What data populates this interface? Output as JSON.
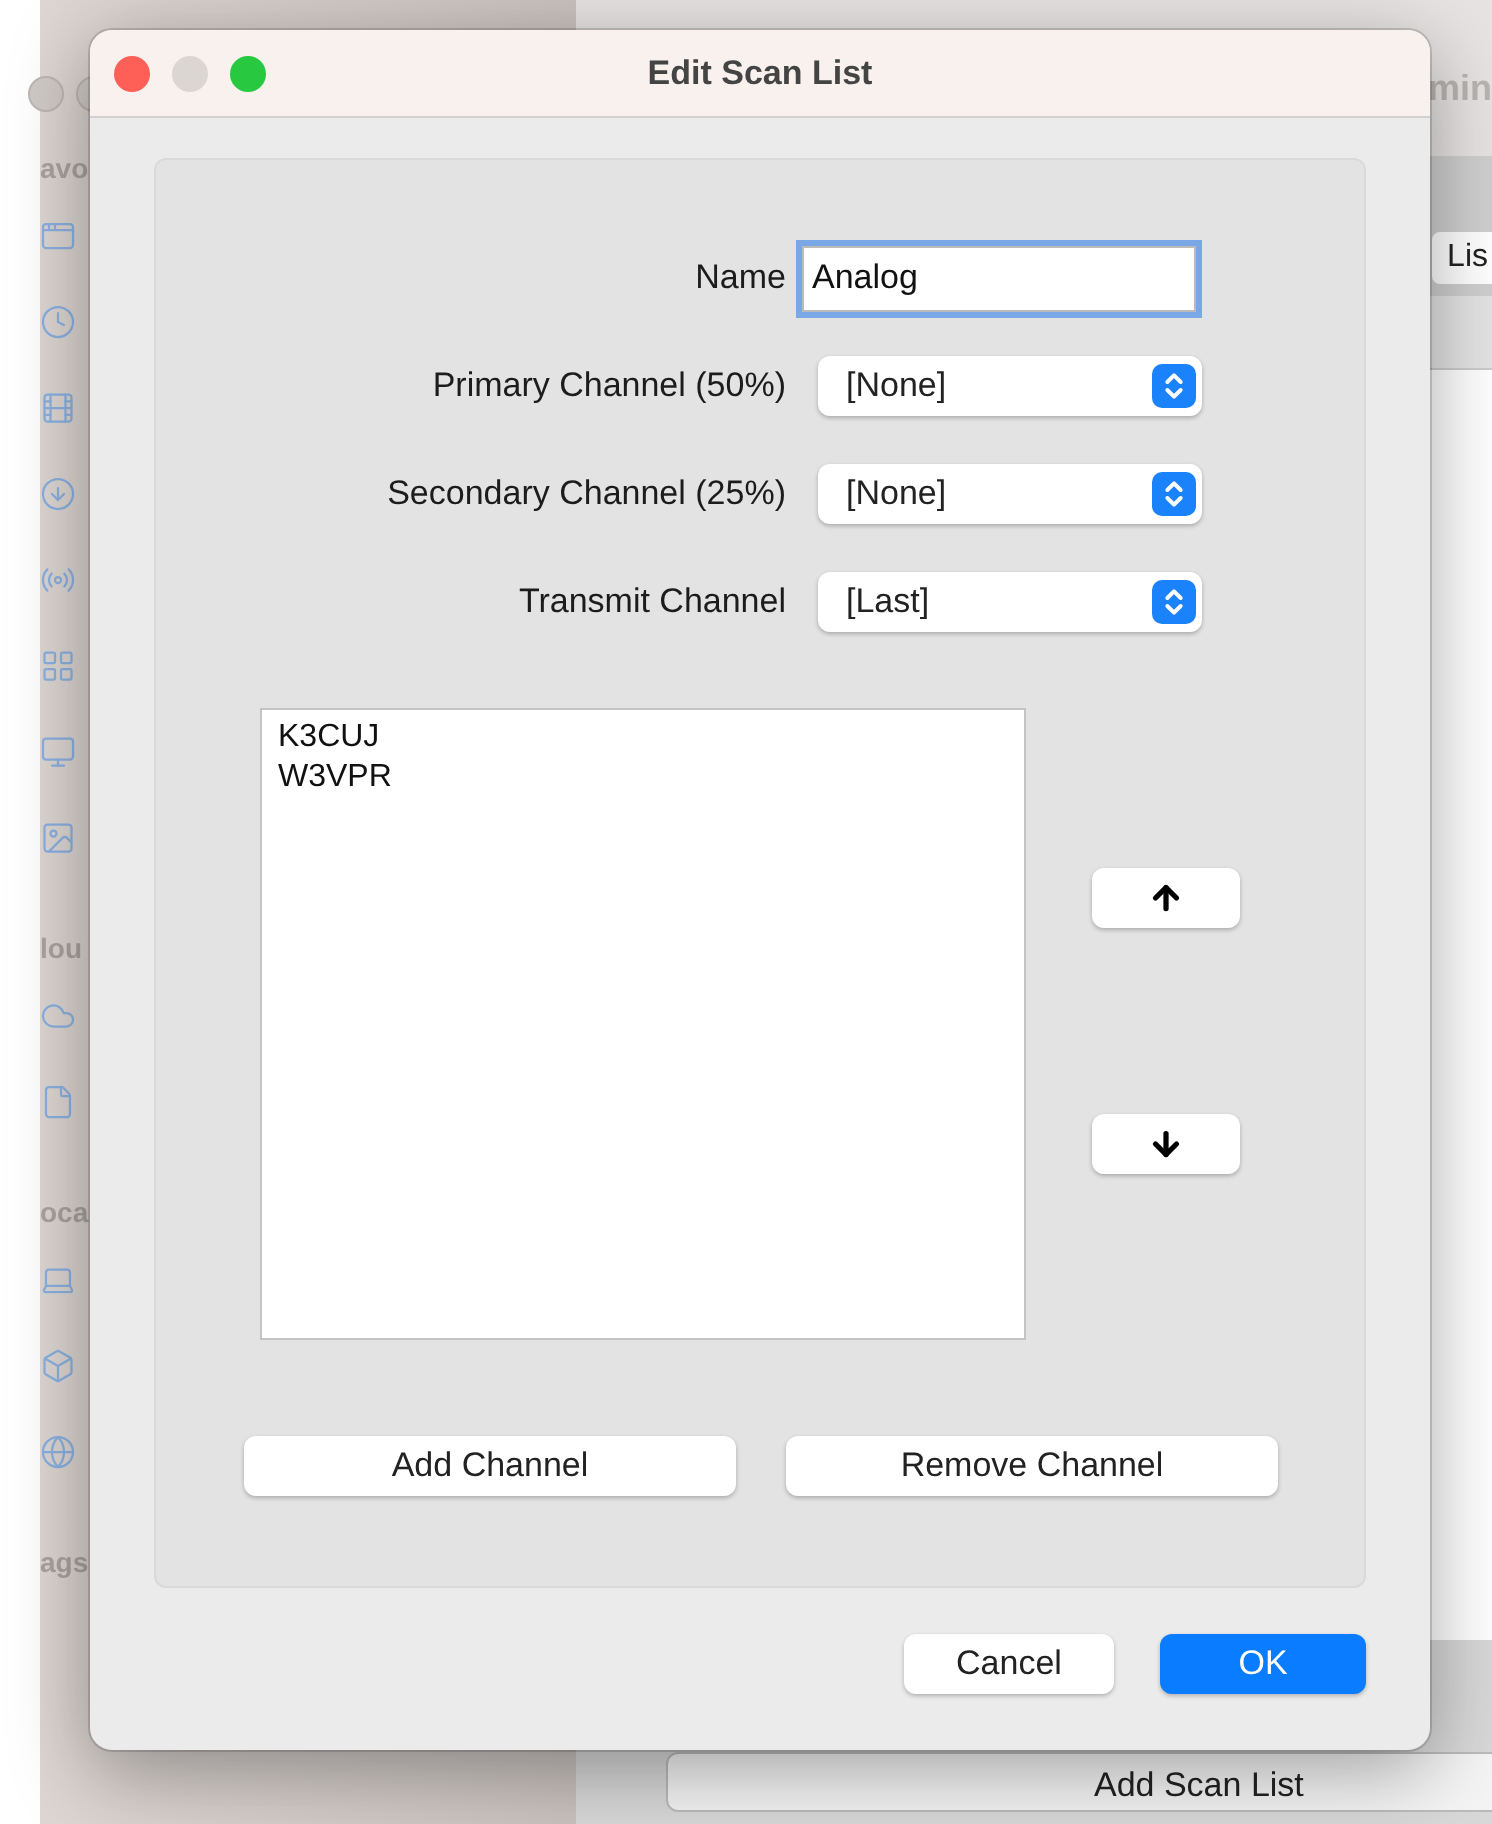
{
  "background_window": {
    "title": "min",
    "sidebar": [
      {
        "heading": "avo",
        "icons": [
          {
            "kind": "app"
          },
          {
            "kind": "clock"
          },
          {
            "kind": "film"
          },
          {
            "kind": "download"
          },
          {
            "kind": "airdrop"
          },
          {
            "kind": "apps"
          },
          {
            "kind": "desktop"
          },
          {
            "kind": "photo"
          }
        ]
      },
      {
        "heading": "lou",
        "icons": [
          {
            "kind": "cloud"
          },
          {
            "kind": "document"
          }
        ]
      },
      {
        "heading": "oca",
        "icons": [
          {
            "kind": "laptop"
          },
          {
            "kind": "dropbox"
          },
          {
            "kind": "network"
          }
        ]
      },
      {
        "heading": "ags"
      }
    ],
    "toolbar_button": "Lis",
    "add_button": "Add Scan List"
  },
  "dialog": {
    "title": "Edit Scan List",
    "window_controls": [
      {
        "kind": "close",
        "disabled": false
      },
      {
        "kind": "minimize",
        "disabled": true
      },
      {
        "kind": "zoom",
        "disabled": false
      }
    ],
    "name_field": {
      "label": "Name",
      "value": "Analog",
      "focused": true
    },
    "popups": [
      {
        "label": "Primary Channel (50%)",
        "value": "[None]"
      },
      {
        "label": "Secondary Channel (25%)",
        "value": "[None]"
      },
      {
        "label": "Transmit Channel",
        "value": "[Last]"
      }
    ],
    "channels": [
      {
        "name": "K3CUJ",
        "selected": false
      },
      {
        "name": "W3VPR",
        "selected": false
      }
    ],
    "move_buttons": [
      {
        "kind": "up"
      },
      {
        "kind": "down"
      }
    ],
    "list_buttons": [
      "Add Channel",
      "Remove Channel"
    ],
    "footer_buttons": [
      {
        "label": "Cancel",
        "default": false
      },
      {
        "label": "OK",
        "default": true
      }
    ]
  }
}
